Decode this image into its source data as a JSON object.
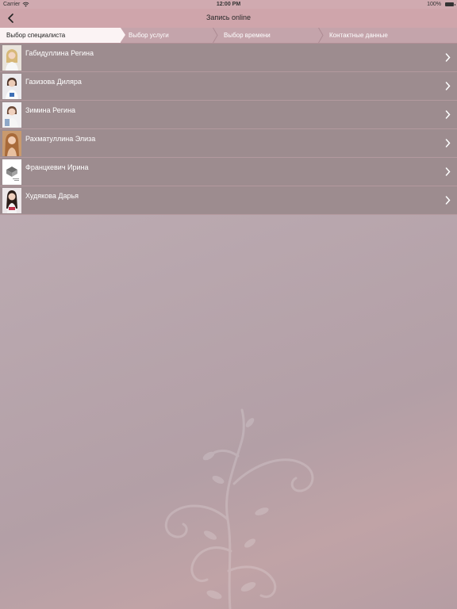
{
  "status_bar": {
    "carrier": "Carrier",
    "time": "12:00 PM",
    "battery": "100%"
  },
  "nav": {
    "title": "Запись online"
  },
  "steps": [
    {
      "label": "Выбор специалиста",
      "active": true
    },
    {
      "label": "Выбор услуги",
      "active": false
    },
    {
      "label": "Выбор времени",
      "active": false
    },
    {
      "label": "Контактные данные",
      "active": false
    }
  ],
  "specialists": [
    {
      "name": "Габидуллина Регина"
    },
    {
      "name": "Газизова Диляра"
    },
    {
      "name": "Зимина Регина"
    },
    {
      "name": "Рахматуллина Элиза"
    },
    {
      "name": "Францкевич Ирина"
    },
    {
      "name": "Худякова Дарья"
    }
  ],
  "icons": {
    "back": "chevron-left-icon",
    "row_arrow": "chevron-right-icon",
    "wifi": "wifi-icon",
    "battery": "battery-icon"
  },
  "colors": {
    "nav_bar": "#cfa5ab",
    "row_bg": "#9d8c8f",
    "active_step_bg": "#fbf3f4"
  }
}
